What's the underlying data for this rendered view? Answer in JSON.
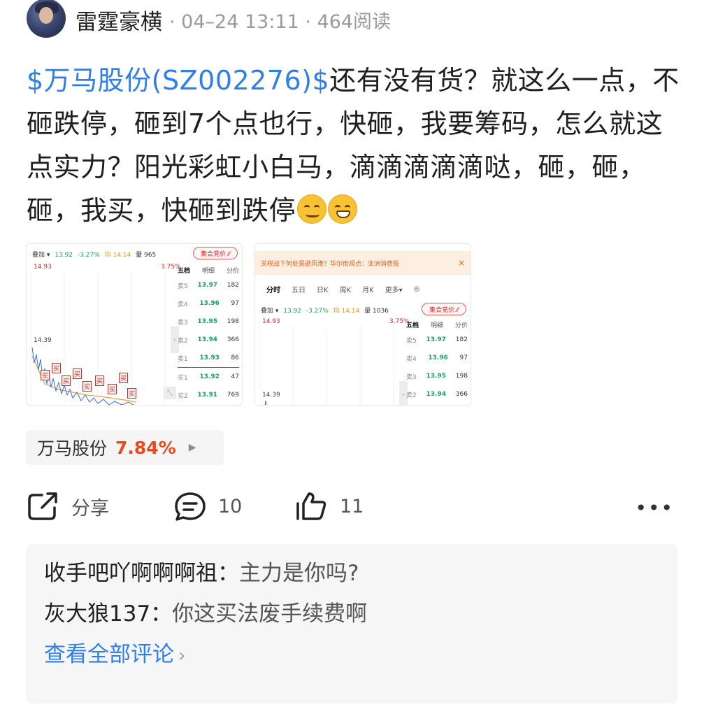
{
  "author": {
    "name": "雷霆豪横",
    "meta": "· 04–24 13:11 · 464阅读"
  },
  "post": {
    "stock_tag": "$万马股份(SZ002276)$",
    "text": "还有没有货？就这么一点，不砸跌停，砸到7个点也行，快砸，我要筹码，怎么就这点实力？阳光彩虹小白马，滴滴滴滴滴哒，砸，砸，砸，我买，快砸到跌停",
    "emojis": [
      "smirk-emoji",
      "grin-emoji"
    ]
  },
  "screenshot1": {
    "topbar": {
      "overlay": "叠加 ▾",
      "price": "13.92",
      "change": "-3.27%",
      "avg": "均 14.14",
      "vol": "量 965"
    },
    "bid_button": "集合竞价 ⁄⁄",
    "y_high": "14.93",
    "y_mid": "14.39",
    "pct_high": "3.75%",
    "orderbook": {
      "headers": [
        "五档",
        "明细",
        "分价"
      ],
      "rows": [
        {
          "label": "卖5",
          "price": "13.97",
          "qty": "182"
        },
        {
          "label": "卖4",
          "price": "13.96",
          "qty": "97"
        },
        {
          "label": "卖3",
          "price": "13.95",
          "qty": "198"
        },
        {
          "label": "卖2",
          "price": "13.94",
          "qty": "366"
        },
        {
          "label": "卖1",
          "price": "13.93",
          "qty": "86"
        },
        {
          "label": "买1",
          "price": "13.92",
          "qty": "47"
        },
        {
          "label": "买2",
          "price": "13.91",
          "qty": "769"
        }
      ]
    },
    "trade_marker": "买"
  },
  "screenshot2": {
    "banner": "关税战下何处是避风港？华尔街观点：亚洲消费股",
    "banner_close": "×",
    "tabs": [
      "分时",
      "五日",
      "日K",
      "周K",
      "月K",
      "更多▾",
      "◎"
    ],
    "topbar": {
      "overlay": "叠加 ▾",
      "price": "13.92",
      "change": "-3.27%",
      "avg": "均 14.14",
      "vol": "量 1036"
    },
    "bid_button": "集合竞价 ⁄⁄",
    "y_high": "14.93",
    "y_mid": "14.39",
    "pct_high": "3.75%",
    "orderbook": {
      "headers": [
        "五档",
        "明细",
        "分价"
      ],
      "rows": [
        {
          "label": "卖5",
          "price": "13.97",
          "qty": "182"
        },
        {
          "label": "卖4",
          "price": "13.96",
          "qty": "97"
        },
        {
          "label": "卖3",
          "price": "13.95",
          "qty": "198"
        },
        {
          "label": "卖2",
          "price": "13.94",
          "qty": "366"
        }
      ]
    }
  },
  "stock_chip": {
    "name": "万马股份",
    "change": "7.84%",
    "arrow": "▶"
  },
  "actions": {
    "share": "分享",
    "comments": "10",
    "likes": "11",
    "more": "•••"
  },
  "comments": [
    {
      "user": "收手吧吖啊啊啊祖",
      "text": "主力是你吗?"
    },
    {
      "user": "灰大狼137",
      "text": "你这买法废手续费啊"
    }
  ],
  "view_all": "查看全部评论",
  "view_all_chevron": "›",
  "colors": {
    "link_blue": "#2f7fe9",
    "rise_red": "#e64b1f",
    "fall_green": "#1aa35a"
  }
}
